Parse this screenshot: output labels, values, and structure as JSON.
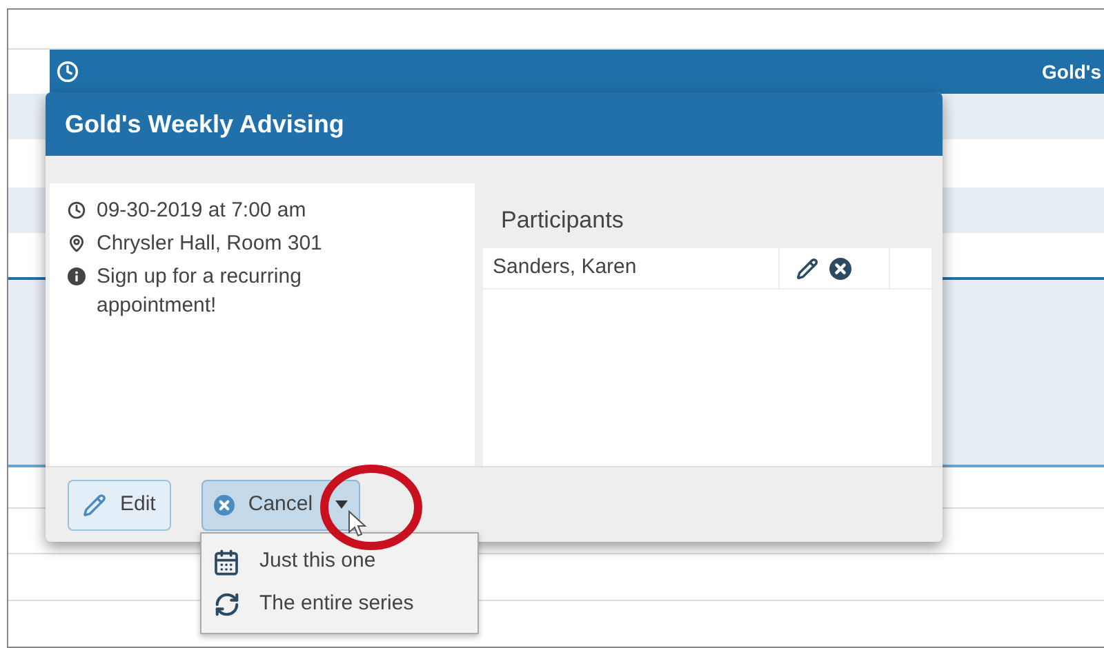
{
  "event_bar": {
    "title": "Gold's"
  },
  "popup": {
    "title": "Gold's Weekly Advising",
    "details": [
      {
        "kind": "time",
        "text": "09-30-2019 at 7:00 am"
      },
      {
        "kind": "location",
        "text": "Chrysler Hall, Room 301"
      },
      {
        "kind": "info",
        "text": "Sign up for a recurring appointment!"
      }
    ],
    "participants": {
      "heading": "Participants",
      "rows": [
        {
          "name": "Sanders, Karen"
        }
      ]
    },
    "buttons": [
      {
        "kind": "edit",
        "label": "Edit"
      },
      {
        "kind": "cancel",
        "label": "Cancel",
        "expanded": true
      }
    ],
    "menu": [
      {
        "kind": "calendar",
        "label": "Just this one"
      },
      {
        "kind": "refresh",
        "label": "The entire series"
      }
    ]
  }
}
